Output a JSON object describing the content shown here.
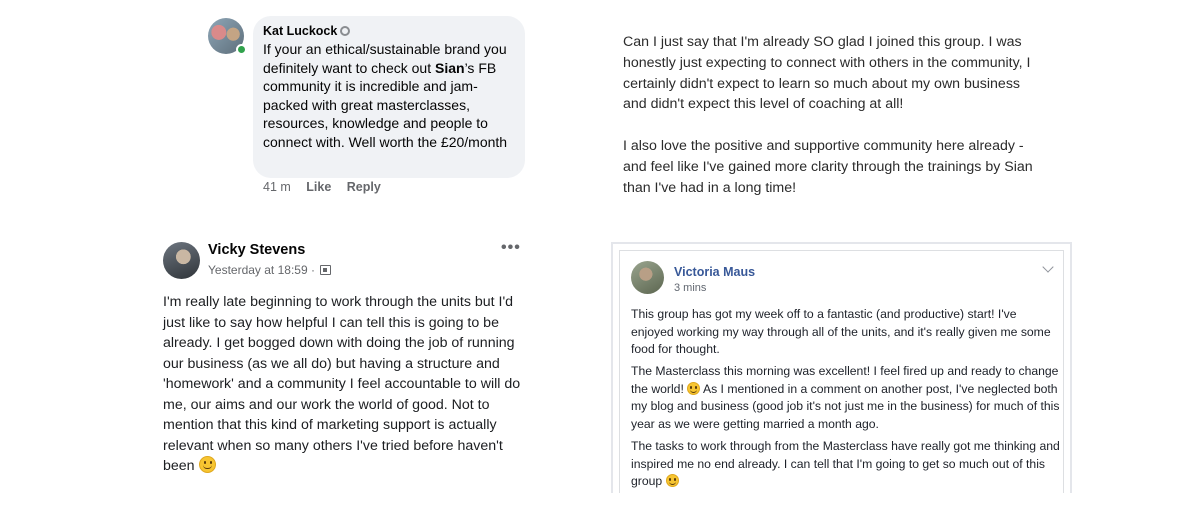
{
  "kat_comment": {
    "author": "Kat Luckock",
    "text_before": "If your an ethical/sustainable brand you definitely want to check out ",
    "mention": "Sian",
    "text_after": "’s FB community it is incredible and jam-packed with great masterclasses, resources, knowledge and people to connect with. Well worth the £20/month",
    "time": "41 m",
    "like_label": "Like",
    "reply_label": "Reply"
  },
  "quote": {
    "paragraphs": [
      "Can I just say that I'm already SO glad I joined this group. I was honestly just expecting to connect with others in the community, I certainly didn't expect to learn so much about my own business and didn't expect this level of coaching at all!",
      "I also love the positive and supportive community here already - and feel like I've gained more clarity through the trainings by Sian than I've had in a long time!"
    ]
  },
  "vicky_post": {
    "author": "Vicky Stevens",
    "timestamp": "Yesterday at 18:59 ·",
    "more_label": "•••",
    "text": "I'm really late beginning to work through the units but I'd just like to say how helpful I can tell this is going to be already. I get bogged down with doing the job of running our business (as we all do) but having a structure and 'homework' and a community I feel accountable to will do me, our aims and our work the world of good. Not to mention that this kind of marketing support is actually relevant when so many others I've tried before haven't been "
  },
  "victoria_post": {
    "author": "Victoria Maus",
    "time": "3 mins",
    "p1": "This group has got my week off to a fantastic (and productive) start! I've enjoyed working my way through all of the units, and it's really given me some food for thought.",
    "p2a": "The Masterclass this morning was excellent! I feel fired up and ready to change the world! ",
    "p2b": " As I mentioned in a comment on another post, I've neglected both my blog and business (good job it's not just me in the business) for much of this year as we were getting married a month ago.",
    "p3": "The tasks to work through from the Masterclass have really got me thinking and inspired me no end already. I can tell that I'm going to get so much out of this group "
  }
}
